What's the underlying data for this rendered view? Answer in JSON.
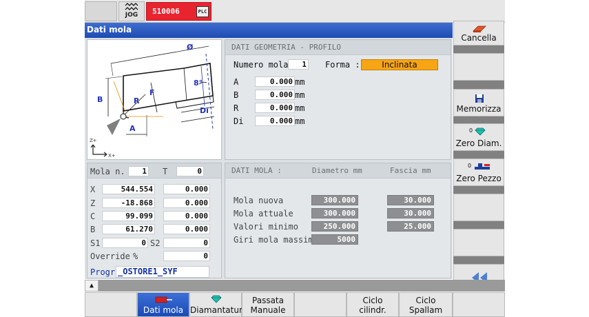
{
  "status": {
    "mode": "JOG",
    "alarm_number": "510006",
    "plc_label": "PLC"
  },
  "title": "Dati mola",
  "drawing": {
    "label_phi": "Ø",
    "label_angle": "8°",
    "label_b": "B",
    "label_r": "R",
    "label_f": "F",
    "label_di": "Di",
    "label_a": "A",
    "label_zp": "Z+",
    "label_xp": "X+"
  },
  "geometry": {
    "header": "DATI GEOMETRIA - PROFILO",
    "numero_label": "Numero mola",
    "numero_value": "1",
    "forma_label": "Forma :",
    "forma_value": "Inclinata",
    "rows": [
      {
        "label": "A",
        "value": "0.000",
        "unit": "mm"
      },
      {
        "label": "B",
        "value": "0.000",
        "unit": "mm"
      },
      {
        "label": "R",
        "value": "0.000",
        "unit": "mm"
      },
      {
        "label": "Di",
        "value": "0.000",
        "unit": "mm"
      }
    ]
  },
  "position": {
    "mola_label": "Mola n.",
    "mola_value": "1",
    "t_label": "T",
    "t_value": "0",
    "axes": [
      {
        "axis": "X",
        "pos": "544.554",
        "dist": "0.000"
      },
      {
        "axis": "Z",
        "pos": "-18.868",
        "dist": "0.000"
      },
      {
        "axis": "C",
        "pos": "99.099",
        "dist": "0.000"
      },
      {
        "axis": "B",
        "pos": "61.270",
        "dist": "0.000"
      }
    ],
    "s1_label": "S1",
    "s1_value": "0",
    "s2_label": "S2",
    "s2_value": "0",
    "override_label": "Override",
    "override_unit": "%",
    "override_value": "0",
    "prog_label": "Progr :",
    "prog_value": "_OSTORE1_SYF"
  },
  "mola_data": {
    "header": "DATI MOLA :",
    "col1": "Diametro mm",
    "col2": "Fascia mm",
    "rows": [
      {
        "label": "Mola nuova",
        "diam": "300.000",
        "fascia": "30.000"
      },
      {
        "label": "Mola attuale",
        "diam": "300.000",
        "fascia": "30.000"
      },
      {
        "label": "Valori minimo",
        "diam": "250.000",
        "fascia": "25.000"
      },
      {
        "label": "Giri mola massimi",
        "diam": "5000"
      }
    ]
  },
  "softkeys_right": {
    "cancella": "Cancella",
    "memorizza": "Memorizza",
    "zero_diam": "Zero Diam.",
    "zero_pezzo": "Zero Pezzo",
    "zero_sym": "0"
  },
  "softkeys_bottom": {
    "dati_mola": "Dati mola",
    "diamantatura": "Diamantatura",
    "passata_1": "Passata",
    "passata_2": "Manuale",
    "ciclo_cil_1": "Ciclo",
    "ciclo_cil_2": "cilindr.",
    "ciclo_spa_1": "Ciclo",
    "ciclo_spa_2": "Spallam"
  },
  "colors": {
    "title_blue": "#1d4bb2",
    "alarm_red": "#e8242f",
    "forma_orange": "#f7a514",
    "field_dark": "#8d8f92"
  }
}
